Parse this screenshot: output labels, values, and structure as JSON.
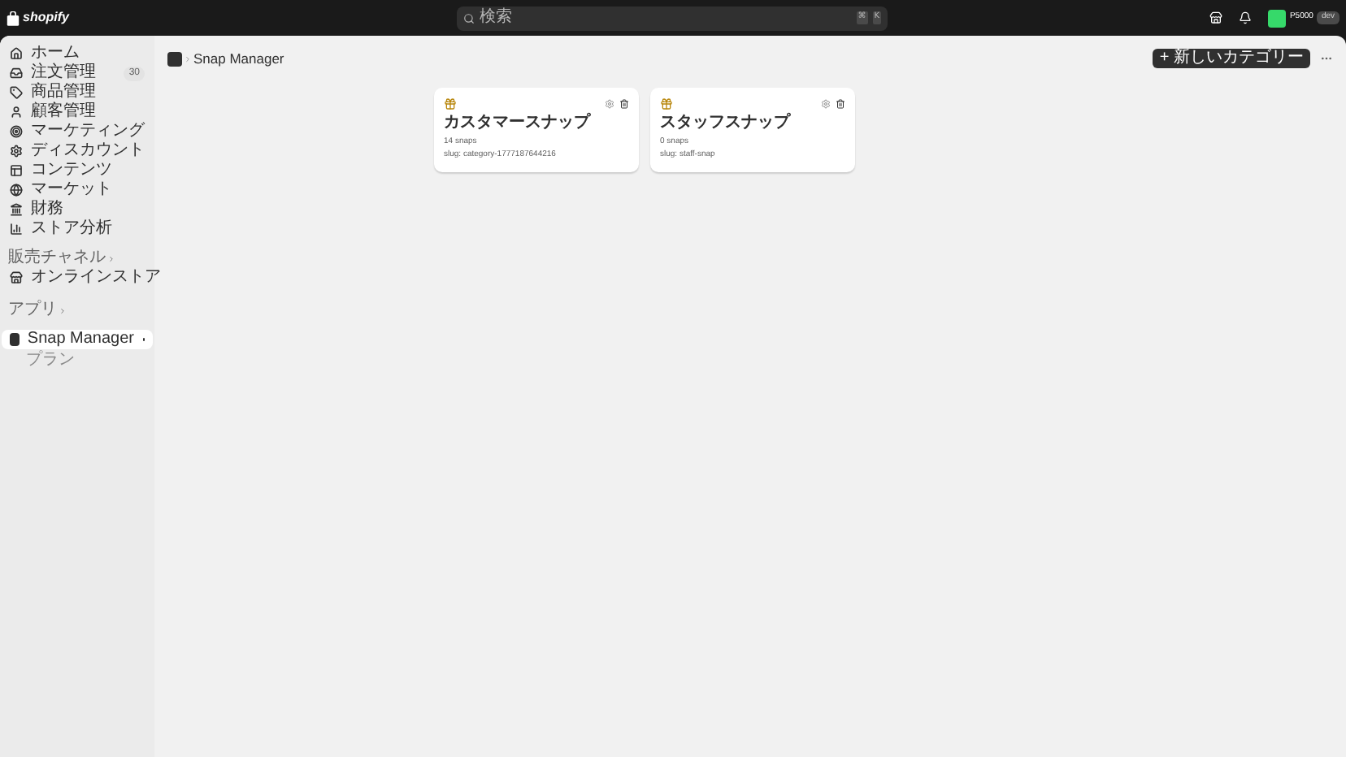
{
  "topbar": {
    "logo": "shopify",
    "search": {
      "placeholder": "検索",
      "keys": [
        "⌘",
        "K"
      ]
    },
    "store": "P5000",
    "badge": "dev"
  },
  "sidebar": {
    "items": [
      {
        "kind": "home",
        "label": "ホーム",
        "selected": false
      },
      {
        "kind": "orders",
        "label": "注文管理",
        "count": "30",
        "selected": false
      },
      {
        "kind": "products",
        "label": "商品管理",
        "selected": false
      },
      {
        "kind": "customers",
        "label": "顧客管理",
        "selected": false
      },
      {
        "kind": "marketing",
        "label": "マーケティング",
        "selected": false
      },
      {
        "kind": "discounts",
        "label": "ディスカウント",
        "selected": false
      },
      {
        "kind": "content",
        "label": "コンテンツ",
        "selected": false
      },
      {
        "kind": "markets",
        "label": "マーケット",
        "selected": false
      },
      {
        "kind": "finance",
        "label": "財務",
        "selected": false
      },
      {
        "kind": "analytics",
        "label": "ストア分析",
        "selected": false
      }
    ],
    "channels_heading": "販売チャネル",
    "channels": [
      {
        "kind": "store",
        "label": "オンラインストア",
        "selected": false
      }
    ],
    "apps_heading": "アプリ",
    "apps": [
      {
        "kind": "app",
        "label": "Snap Manager",
        "selected": true,
        "children": [
          {
            "label": "プラン"
          }
        ]
      }
    ]
  },
  "page": {
    "title": "Snap Manager",
    "new_button": "+ 新しいカテゴリー",
    "categories": [
      {
        "name": "カスタマースナップ",
        "count": "14 snaps",
        "slug": "slug: category-1777187644216"
      },
      {
        "name": "スタッフスナップ",
        "count": "0 snaps",
        "slug": "slug: staff-snap"
      }
    ]
  }
}
